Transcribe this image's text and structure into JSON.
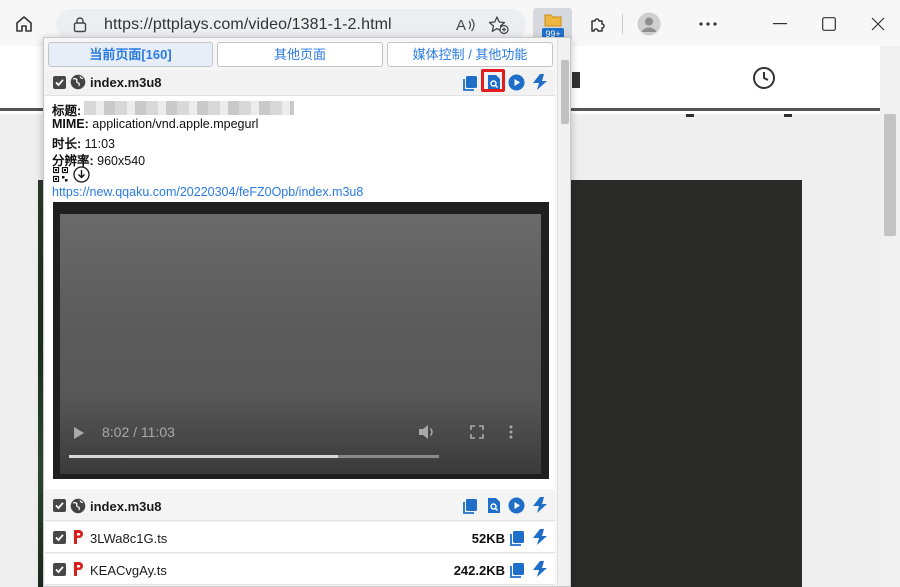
{
  "browser": {
    "url": "https://pttplays.com/video/1381-1-2.html",
    "extension_badge": "99+"
  },
  "popup": {
    "tabs": [
      {
        "label": "当前页面[160]",
        "active": true
      },
      {
        "label": "其他页面",
        "active": false
      },
      {
        "label": "媒体控制 / 其他功能",
        "active": false
      }
    ],
    "main_item": {
      "name": "index.m3u8",
      "tooltip": "解析",
      "info": {
        "title_label": "标题:",
        "mime_label": "MIME:",
        "mime_value": "application/vnd.apple.mpegurl",
        "duration_label": "时长:",
        "duration_value": "11:03",
        "resolution_label": "分辨率:",
        "resolution_value": "960x540"
      },
      "link": "https://new.qqaku.com/20220304/feFZ0Opb/index.m3u8"
    },
    "player": {
      "time": "8:02 / 11:03",
      "progress_fraction": 0.727
    },
    "items": [
      {
        "name": "index.m3u8",
        "size": "",
        "type": "m3u8"
      },
      {
        "name": "3LWa8c1G.ts",
        "size": "52KB",
        "type": "ts"
      },
      {
        "name": "KEACvgAy.ts",
        "size": "242.2KB",
        "type": "ts"
      }
    ]
  },
  "colors": {
    "accent": "#1f6fc9",
    "link": "#2a7ae2",
    "highlight": "#e11d1d"
  }
}
